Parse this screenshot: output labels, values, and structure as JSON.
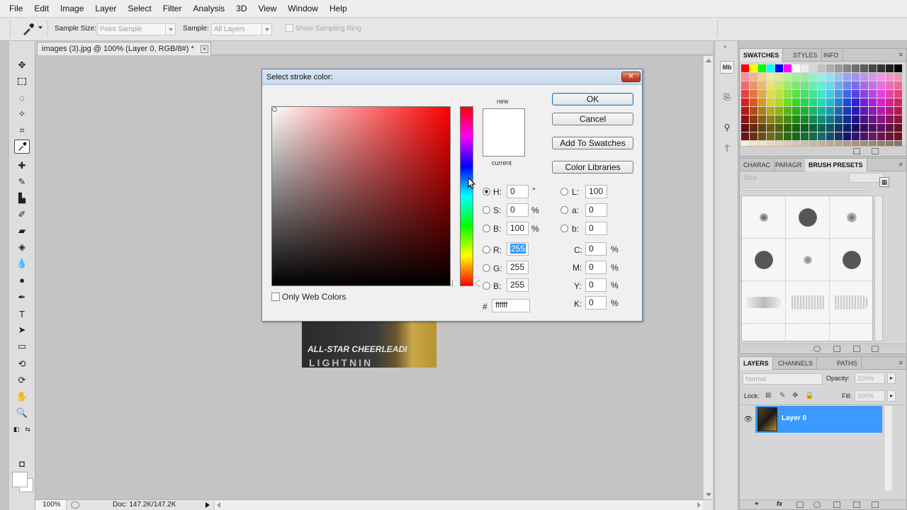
{
  "menu": [
    "File",
    "Edit",
    "Image",
    "Layer",
    "Select",
    "Filter",
    "Analysis",
    "3D",
    "View",
    "Window",
    "Help"
  ],
  "options_bar": {
    "sample_size_label": "Sample Size:",
    "sample_size_value": "Point Sample",
    "sample_label": "Sample:",
    "sample_value": "All Layers",
    "sampling_ring_label": "Show Sampling Ring"
  },
  "document": {
    "tab_title": "images (3).jpg @ 100% (Layer 0, RGB/8#) *",
    "close_glyph": "×",
    "image_text": [
      "",
      "ALL-STAR CHEERLEADI",
      "LIGHTNIN"
    ]
  },
  "status": {
    "zoom": "100%",
    "doc": "Doc: 147.2K/147.2K"
  },
  "dialog": {
    "title": "Select stroke color:",
    "close_glyph": "✕",
    "new_label": "new",
    "current_label": "current",
    "buttons": {
      "ok": "OK",
      "cancel": "Cancel",
      "add_swatches": "Add To Swatches",
      "color_libraries": "Color Libraries"
    },
    "only_web_colors": "Only Web Colors",
    "hsb": [
      {
        "label": "H:",
        "value": "0",
        "unit": "°",
        "selected": true
      },
      {
        "label": "S:",
        "value": "0",
        "unit": "%",
        "selected": false
      },
      {
        "label": "B:",
        "value": "100",
        "unit": "%",
        "selected": false
      }
    ],
    "rgb": [
      {
        "label": "R:",
        "value": "255"
      },
      {
        "label": "G:",
        "value": "255"
      },
      {
        "label": "B:",
        "value": "255"
      }
    ],
    "lab": [
      {
        "label": "L:",
        "value": "100"
      },
      {
        "label": "a:",
        "value": "0"
      },
      {
        "label": "b:",
        "value": "0"
      }
    ],
    "cmyk": [
      {
        "label": "C:",
        "value": "0",
        "unit": "%"
      },
      {
        "label": "M:",
        "value": "0",
        "unit": "%"
      },
      {
        "label": "Y:",
        "value": "0",
        "unit": "%"
      },
      {
        "label": "K:",
        "value": "0",
        "unit": "%"
      }
    ],
    "hex_label": "#",
    "hex_value": "ffffff",
    "new_color": "#ffffff",
    "current_color": "#ffffff"
  },
  "panels": {
    "swatches_tabs": [
      "SWATCHES",
      "STYLES",
      "INFO"
    ],
    "brush_tabs": [
      "CHARAC",
      "PARAGR",
      "BRUSH PRESETS"
    ],
    "brush_size_label": "Size:",
    "layers_tabs": [
      "LAYERS",
      "CHANNELS",
      "PATHS"
    ],
    "blend_mode": "Normal",
    "opacity_label": "Opacity:",
    "opacity_value": "100%",
    "lock_label": "Lock:",
    "fill_label": "Fill:",
    "fill_value": "100%",
    "layer_name": "Layer 0"
  },
  "colors": {
    "layer_selected": "#3a9aff",
    "dialog_title": "#c9d8ec"
  }
}
